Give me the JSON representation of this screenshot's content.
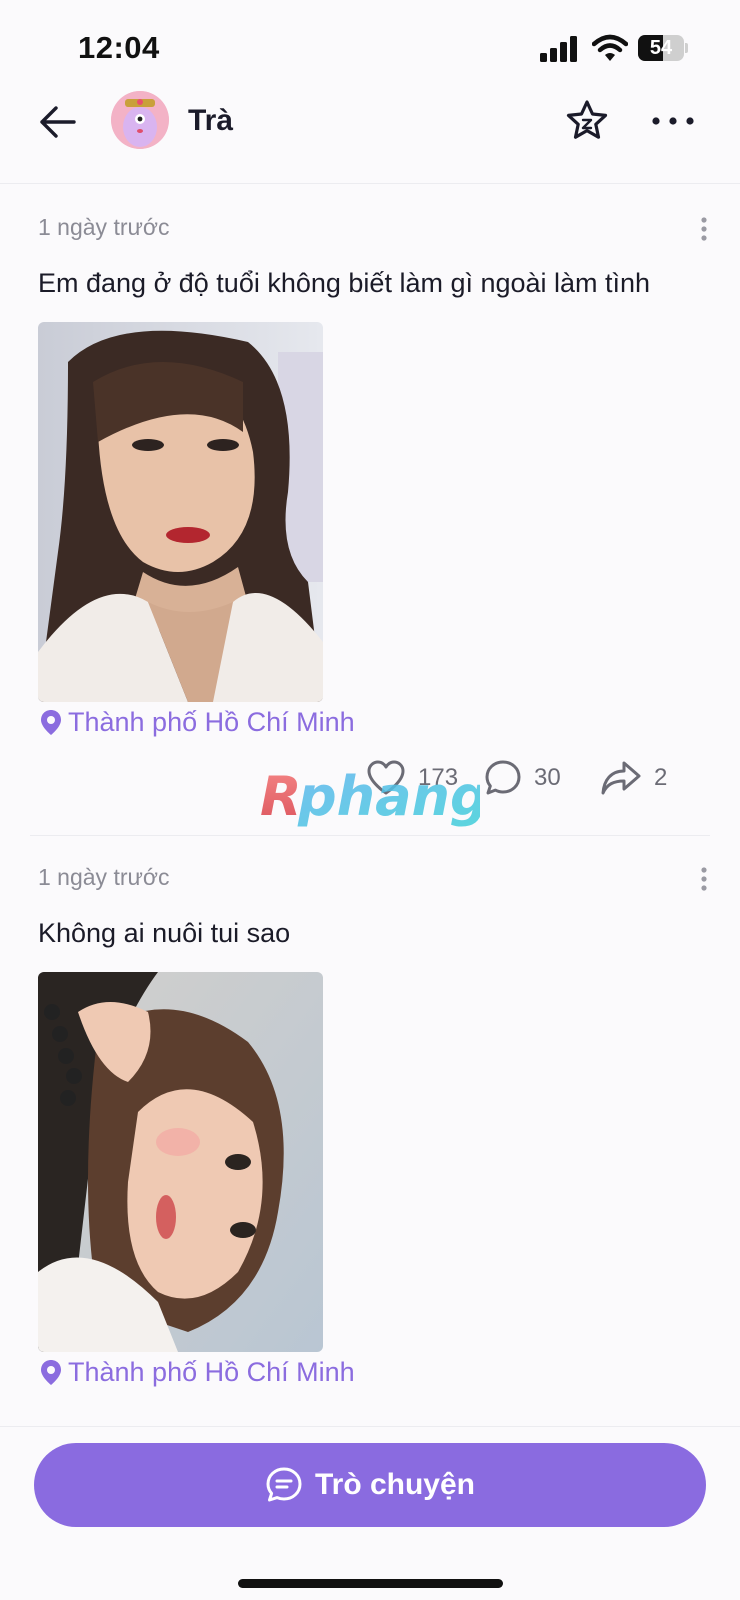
{
  "status_bar": {
    "time": "12:04",
    "battery_level": "54",
    "battery_fraction": 0.54
  },
  "header": {
    "profile_name": "Trà",
    "back_icon": "arrow-left-icon",
    "star_icon": "star-icon",
    "more_icon": "more-horizontal-icon"
  },
  "posts": [
    {
      "time": "1 ngày trước",
      "text": "Em đang ở độ tuổi không biết làm gì ngoài làm tình",
      "location": "Thành phố Hồ Chí Minh",
      "likes": "173",
      "comments": "30",
      "shares": "2"
    },
    {
      "time": "1 ngày trước",
      "text": "Không ai nuôi tui sao",
      "location": "Thành phố Hồ Chí Minh"
    }
  ],
  "watermark": "Rphang",
  "chat_button": {
    "label": "Trò chuyện"
  },
  "colors": {
    "accent": "#8a6be0",
    "location": "#8b6cdf",
    "background": "#fbfafc"
  }
}
